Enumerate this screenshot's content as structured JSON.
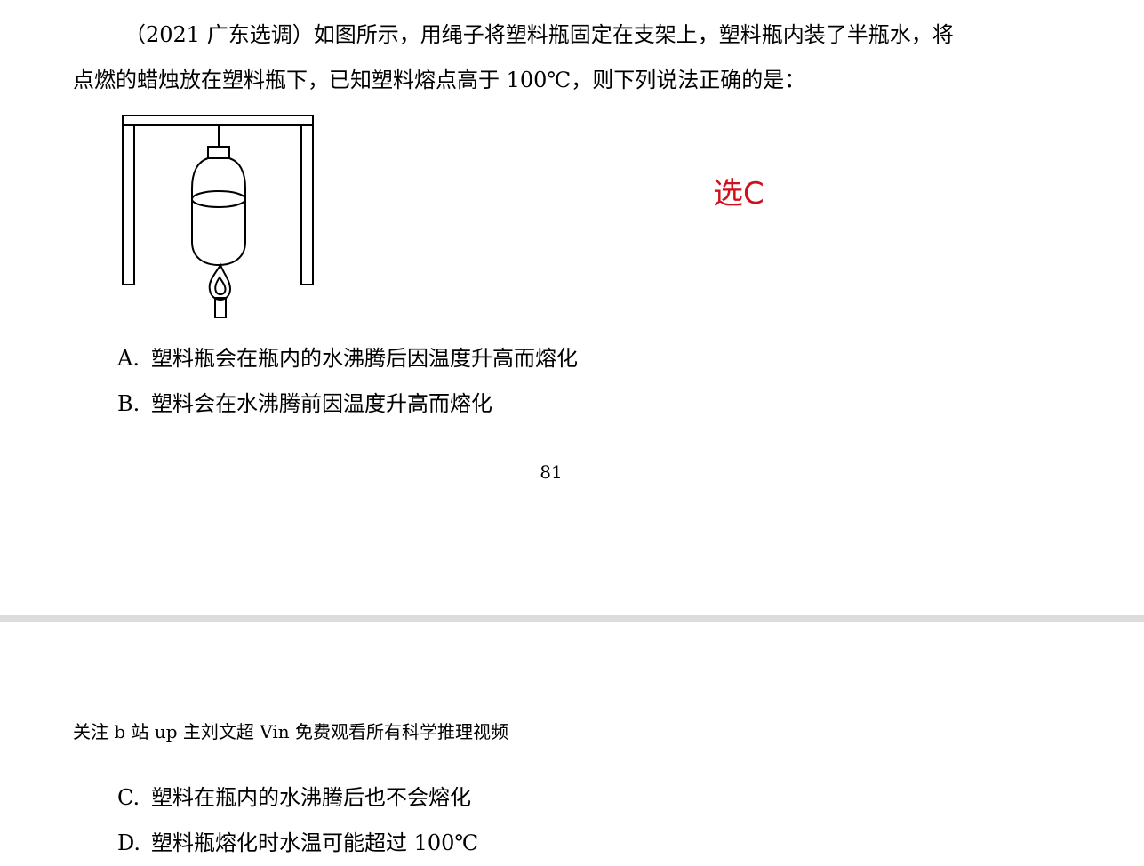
{
  "question": {
    "line1": "（2021 广东选调）如图所示，用绳子将塑料瓶固定在支架上，塑料瓶内装了半瓶水，将",
    "line2": "点燃的蜡烛放在塑料瓶下，已知塑料熔点高于 100℃，则下列说法正确的是："
  },
  "annotation": {
    "text": "选C",
    "color": "#d0101a"
  },
  "options": [
    {
      "key": "A.",
      "text": "塑料瓶会在瓶内的水沸腾后因温度升高而熔化"
    },
    {
      "key": "B.",
      "text": "塑料会在水沸腾前因温度升高而熔化"
    },
    {
      "key": "C.",
      "text": "塑料在瓶内的水沸腾后也不会熔化"
    },
    {
      "key": "D.",
      "text": "塑料瓶熔化时水温可能超过 100℃"
    }
  ],
  "page_number": "81",
  "next_page_header": "关注 b 站 up 主刘文超 Vin 免费观看所有科学推理视频",
  "figure": {
    "icon": "stand-bottle-candle-diagram"
  }
}
